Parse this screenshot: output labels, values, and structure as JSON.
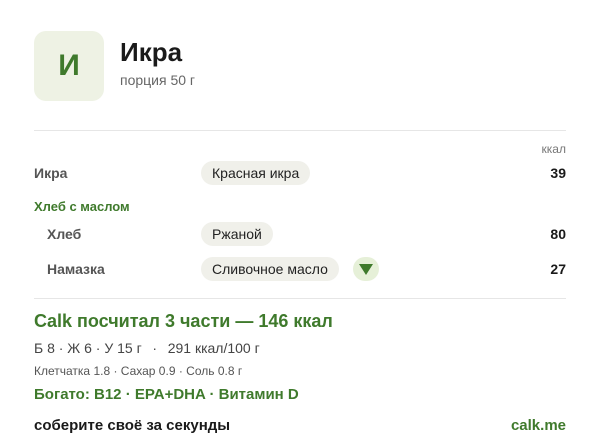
{
  "header": {
    "avatar_letter": "И",
    "title": "Икра",
    "subtitle": "порция 50 г"
  },
  "table": {
    "unit_header": "ккал",
    "rows": [
      {
        "label": "Икра",
        "chip": "Красная икра",
        "kcal": "39"
      }
    ],
    "group": {
      "label": "Хлеб с маслом",
      "rows": [
        {
          "label": "Хлеб",
          "chip": "Ржаной",
          "kcal": "80"
        },
        {
          "label": "Намазка",
          "chip": "Сливочное масло",
          "kcal": "27",
          "expand_icon": "triangle-down-icon"
        }
      ]
    }
  },
  "summary": {
    "headline": "Calk посчитал 3 части — 146 ккал",
    "macros": "Б 8 · Ж 6 · У 15 г",
    "density": "291 ккал/100 г",
    "micro": "Клетчатка 1.8 · Сахар 0.9 · Соль 0.8 г",
    "rich_in": "Богато: B12 · EPA+DHA · Витамин D"
  },
  "footer": {
    "tagline": "соберите своё за секунды",
    "link": "calk.me"
  },
  "colors": {
    "accent": "#3f7a2c",
    "avatar_bg": "#eef2e4",
    "chip_bg": "#f0f0ea"
  }
}
